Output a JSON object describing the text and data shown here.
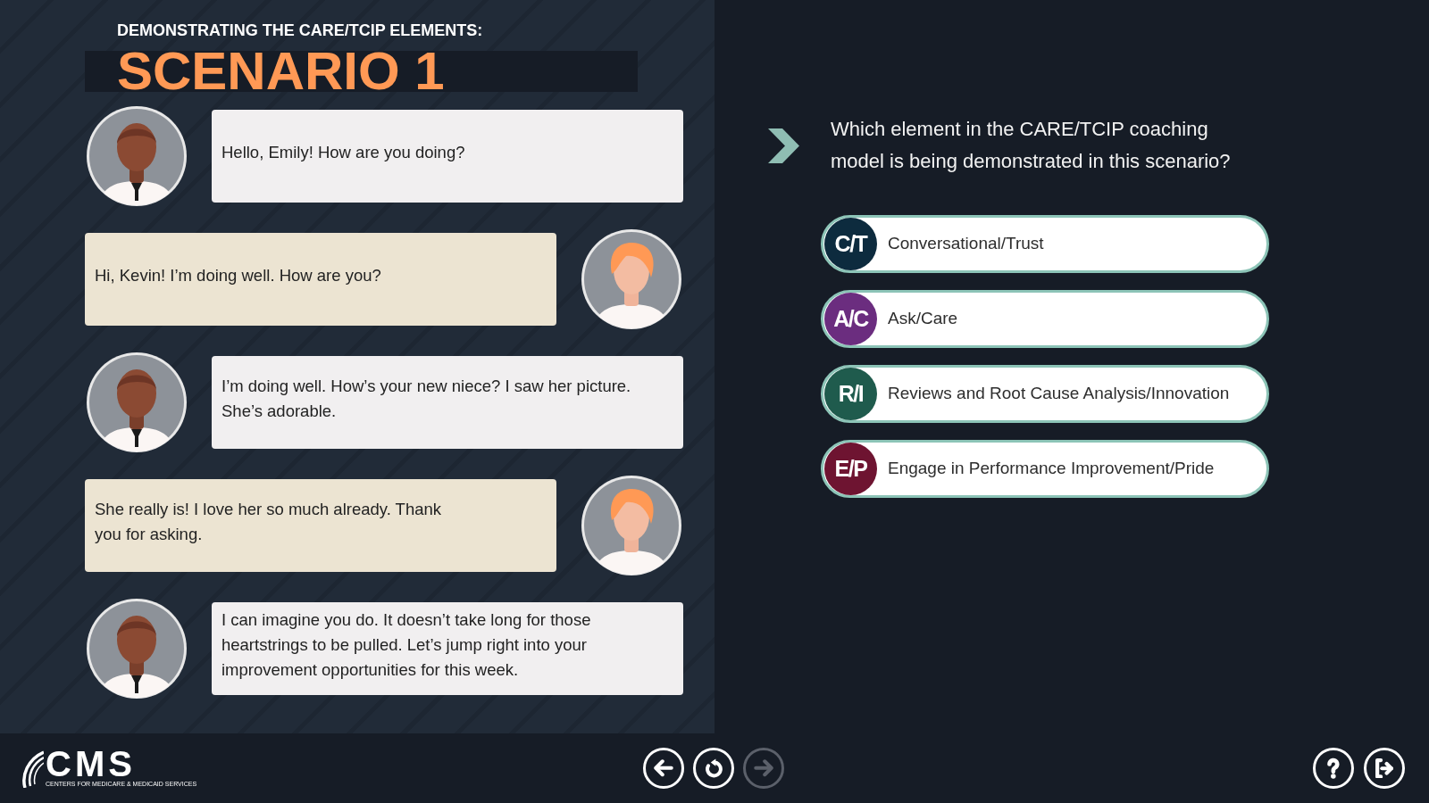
{
  "header": {
    "subtitle": "DEMONSTRATING THE CARE/TCIP ELEMENTS:",
    "title": "SCENARIO 1"
  },
  "messages": [
    {
      "kind": "left",
      "text": "Hello, Emily! How are you doing?"
    },
    {
      "kind": "right",
      "text": "Hi, Kevin! I’m doing well. How are you?"
    },
    {
      "kind": "left",
      "text": "I’m doing well. How’s your new niece? I saw her picture. She’s adorable."
    },
    {
      "kind": "right",
      "text": "She really is! I love her so much already. Thank you for asking."
    },
    {
      "kind": "left",
      "text": "I can imagine you do. It doesn’t take long for those heartstrings to be pulled. Let’s jump right into your improvement opportunities for this week."
    }
  ],
  "question": {
    "text": "Which element in the CARE/TCIP coaching model is being demonstrated in this scenario?"
  },
  "options": [
    {
      "abbreviation": "C/T",
      "label": "Conversational/Trust",
      "color": "#0d2b3e",
      "selected": false
    },
    {
      "abbreviation": "A/C",
      "label": "Ask/Care",
      "color": "#6b2d7f",
      "selected": false
    },
    {
      "abbreviation": "R/I",
      "label": "Reviews and Root Cause Analysis/Innovation",
      "color": "#1f5b4d",
      "selected": false
    },
    {
      "abbreviation": "E/P",
      "label": "Engage in Performance Improvement/Pride",
      "color": "#6e1431",
      "selected": false
    }
  ],
  "logo": {
    "name": "CMS",
    "tagline": "CENTERS FOR MEDICARE & MEDICAID SERVICES"
  },
  "navigation": [
    {
      "kind": "back",
      "disabled": false
    },
    {
      "kind": "replay",
      "disabled": false
    },
    {
      "kind": "next",
      "disabled": true
    }
  ],
  "utility_buttons": [
    {
      "kind": "help",
      "disabled": false
    },
    {
      "kind": "exit",
      "disabled": false
    }
  ]
}
